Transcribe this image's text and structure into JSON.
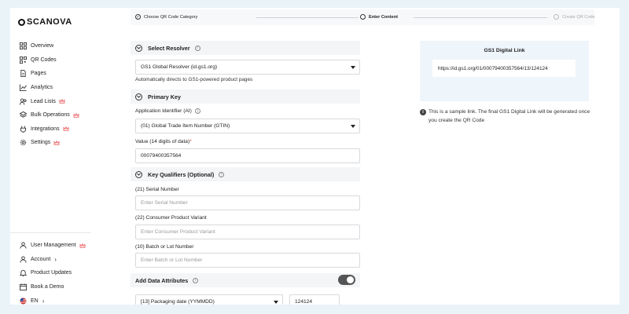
{
  "brand": {
    "name": "SCANOVA"
  },
  "sidebar": {
    "items": [
      {
        "label": "Overview",
        "icon": "grid-icon"
      },
      {
        "label": "QR Codes",
        "icon": "qr-icon"
      },
      {
        "label": "Pages",
        "icon": "page-icon"
      },
      {
        "label": "Analytics",
        "icon": "chart-icon"
      },
      {
        "label": "Lead Lists",
        "icon": "people-icon",
        "badge": "crown"
      },
      {
        "label": "Bulk Operations",
        "icon": "layers-icon",
        "badge": "crown"
      },
      {
        "label": "Integrations",
        "icon": "plug-icon",
        "badge": "crown"
      },
      {
        "label": "Settings",
        "icon": "gear-icon",
        "badge": "crown"
      }
    ],
    "bottom": [
      {
        "label": "User Management",
        "icon": "user-icon",
        "badge": "crown"
      },
      {
        "label": "Account",
        "icon": "person-icon",
        "chevron": "›"
      },
      {
        "label": "Product Updates",
        "icon": "bell-icon"
      },
      {
        "label": "Book a Demo",
        "icon": "calendar-icon"
      },
      {
        "label": "EN",
        "icon": "flag-icon",
        "chevron": "›"
      }
    ],
    "crown_color": "#e8474c"
  },
  "stepper": {
    "steps": [
      {
        "label": "Choose QR Code Category",
        "state": "done"
      },
      {
        "label": "Enter Content",
        "state": "active"
      },
      {
        "label": "Create QR Code",
        "state": "pending"
      }
    ]
  },
  "form": {
    "resolver": {
      "section_title": "Select Resolver",
      "value": "GS1 Global Resolver (id.gs1.org)",
      "helper": "Automatically directs to GS1-powered product pages"
    },
    "primary_key": {
      "section_title": "Primary Key",
      "ai_label": "Application Identifier (AI)",
      "ai_value": "(01) Global Trade Item Number (GTIN)",
      "value_label": "Value (14 digits of data)",
      "required_mark": "*",
      "value": "00079400357564"
    },
    "qualifiers": {
      "section_title": "Key Qualifiers (Optional)",
      "serial_label": "(21) Serial Number",
      "serial_placeholder": "Enter Serial Number",
      "variant_label": "(22) Consumer Product Variant",
      "variant_placeholder": "Enter Consumer Product Variant",
      "batch_label": "(10) Batch or Lot Number",
      "batch_placeholder": "Enter Batch or Lot Number"
    },
    "attributes": {
      "section_title": "Add Data Attributes",
      "toggle_on": true,
      "attr_select": "[13] Packaging date (YYMMDD)",
      "attr_value": "124124"
    }
  },
  "preview": {
    "title": "GS1 Digital Link",
    "link": "https://id.gs1.org/01/00079400357564/13/124124",
    "note": "This is a sample link. The final GS1 Digital Link will be generated once you create the QR Code"
  }
}
